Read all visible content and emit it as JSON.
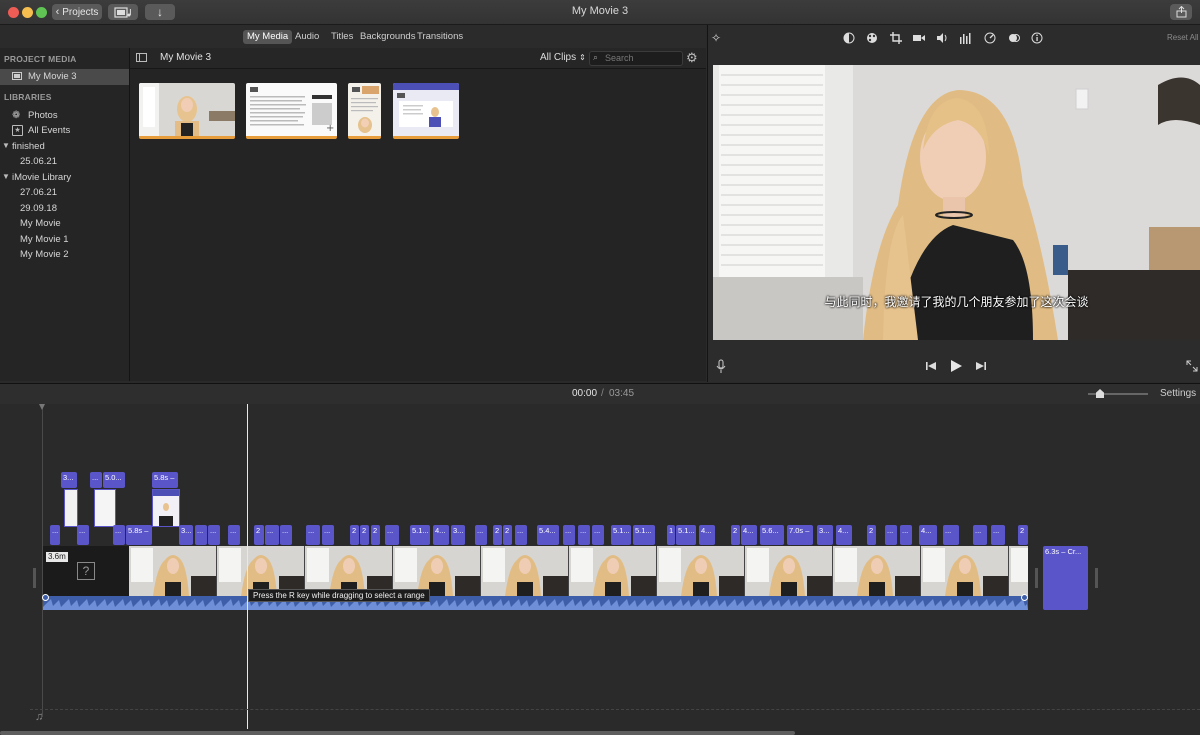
{
  "window": {
    "title": "My Movie 3",
    "projects_label": "Projects"
  },
  "tabs": [
    {
      "label": "My Media"
    },
    {
      "label": "Audio"
    },
    {
      "label": "Titles"
    },
    {
      "label": "Backgrounds"
    },
    {
      "label": "Transitions"
    }
  ],
  "sidebar": {
    "project_media_header": "PROJECT MEDIA",
    "project": "My Movie 3",
    "libraries_header": "LIBRARIES",
    "photos": "Photos",
    "all_events": "All Events",
    "finished": "finished",
    "finished_events": [
      "25.06.21"
    ],
    "imovie_library": "iMovie Library",
    "library_events": [
      "27.06.21",
      "29.09.18",
      "My Movie",
      "My Movie 1",
      "My Movie 2"
    ]
  },
  "browser": {
    "title": "My Movie 3",
    "filter": "All Clips",
    "search_placeholder": "Search"
  },
  "viewer": {
    "reset_all": "Reset All",
    "subtitle": "与此同时，我邀请了我的几个朋友参加了这次会谈"
  },
  "timeline": {
    "current_time": "00:00",
    "separator": "/",
    "total_time": "03:45",
    "settings": "Settings",
    "tooltip": "Press the R key while dragging to select a range",
    "first_clip_label": "3.6m",
    "end_clip_label": "6.3s – Cr...",
    "upper_titles": [
      "3...",
      "...",
      "5.0...",
      "5.8s –"
    ],
    "title_clips": [
      "...",
      "...",
      "...",
      "5.8s –",
      "3...",
      "...",
      "...",
      "...",
      "2",
      "...",
      "...",
      "...",
      "...",
      "2",
      "2",
      "2",
      "...",
      "5.1...",
      "4...",
      "3...",
      "...",
      "2",
      "2",
      "...",
      "5.4...",
      "...",
      "...",
      "...",
      "5.1...",
      "5.1...",
      "1",
      "5.1...",
      "4...",
      "2",
      "4...",
      "5.6...",
      "7.0s –",
      "3...",
      "4...",
      "2",
      "...",
      "...",
      "4...",
      "...",
      "...",
      "...",
      "2"
    ]
  }
}
